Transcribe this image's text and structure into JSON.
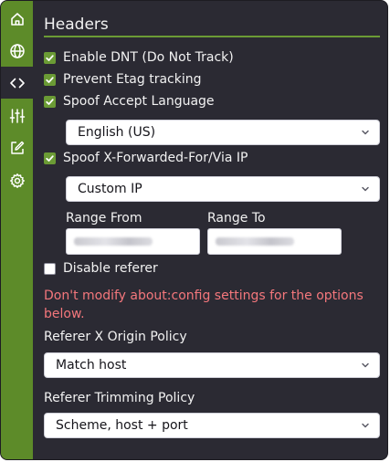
{
  "sidebar": {
    "items": [
      {
        "icon": "home-icon"
      },
      {
        "icon": "globe-icon"
      },
      {
        "icon": "code-icon",
        "active": true
      },
      {
        "icon": "sliders-icon"
      },
      {
        "icon": "edit-icon"
      },
      {
        "icon": "gear-icon"
      }
    ]
  },
  "header": {
    "title": "Headers"
  },
  "options": {
    "enable_dnt": {
      "label": "Enable DNT (Do Not Track)",
      "checked": true
    },
    "prevent_etag": {
      "label": "Prevent Etag tracking",
      "checked": true
    },
    "spoof_language": {
      "label": "Spoof Accept Language",
      "checked": true
    },
    "language_select": {
      "value": "English (US)"
    },
    "spoof_xff": {
      "label": "Spoof X-Forwarded-For/Via IP",
      "checked": true
    },
    "ip_select": {
      "value": "Custom IP"
    },
    "range_from": {
      "label": "Range From"
    },
    "range_to": {
      "label": "Range To"
    },
    "disable_referer": {
      "label": "Disable referer",
      "checked": false
    }
  },
  "warning": "Don't modify about:config settings for the options below.",
  "referer_x_origin": {
    "label": "Referer X Origin Policy",
    "value": "Match host"
  },
  "referer_trimming": {
    "label": "Referer Trimming Policy",
    "value": "Scheme, host + port"
  },
  "colors": {
    "accent": "#6b9b35",
    "sidebar": "#5d8b29",
    "background": "#2b2a33",
    "warning": "#f4777c"
  }
}
